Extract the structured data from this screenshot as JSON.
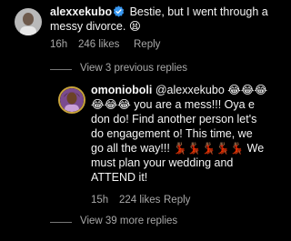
{
  "comments": [
    {
      "username": "alexxekubo",
      "verified": true,
      "text": "Bestie, but I went through a messy divorce. 😫",
      "time": "16h",
      "likes": "246 likes",
      "reply_label": "Reply"
    },
    {
      "username": "omonioboli",
      "verified": false,
      "mention": "@alexxekubo",
      "text": "😂😂😂😂😂😂 you are a mess!!! Oya e don do! Find another person let's do engagement o! This time, we go all the way!!! 💃🏾💃🏾💃🏾💃🏾💃🏾 We must plan your wedding and ATTEND it!",
      "time": "15h",
      "likes": "224 likes",
      "reply_label": "Reply"
    }
  ],
  "view_previous_replies": "View 3 previous replies",
  "view_more_replies": "View 39 more replies",
  "colors": {
    "background": "#000000",
    "text": "#f5f5f5",
    "meta": "#a8a8a8",
    "verified": "#3897f0",
    "story_ring": "#c8a33a"
  }
}
